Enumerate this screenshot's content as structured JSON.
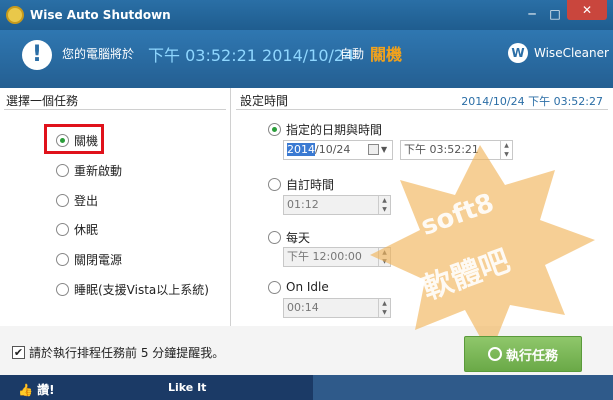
{
  "titlebar": {
    "title": "Wise Auto Shutdown",
    "min": "─",
    "max": "□",
    "close": "✕"
  },
  "header": {
    "prefix": "您的電腦將於",
    "datetime": "下午 03:52:21 2014/10/24",
    "auto": "自動",
    "action": "關機",
    "brand": "WiseCleaner",
    "brand_icon": "W"
  },
  "left": {
    "heading": "選擇一個任務",
    "tasks": [
      "關機",
      "重新啟動",
      "登出",
      "休眠",
      "關閉電源",
      "睡眠(支援Vista以上系統)"
    ],
    "selected_index": 0
  },
  "right": {
    "heading": "設定時間",
    "current_time": "2014/10/24 下午 03:52:27",
    "options": [
      {
        "label": "指定的日期與時間",
        "date": "2014/10/24",
        "date_sel": "2014",
        "date_rest": "/10/24",
        "time": "下午 03:52:21"
      },
      {
        "label": "自訂時間",
        "value": "01:12"
      },
      {
        "label": "每天",
        "value": "下午 12:00:00"
      },
      {
        "label": "On Idle",
        "value": "00:14"
      }
    ],
    "selected_index": 0
  },
  "remind": {
    "checked": true,
    "text": "請於執行排程任務前 5 分鐘提醒我。"
  },
  "run_button": "執行任務",
  "footer": {
    "like": "讚!",
    "likeit": "Like It"
  },
  "watermark": {
    "line1": "soft8",
    "line2": "軟體吧"
  },
  "colors": {
    "accent": "#2b6ea6",
    "action": "#f2a21b",
    "radio": "#2a9d3a",
    "highlight": "#e0121b"
  }
}
